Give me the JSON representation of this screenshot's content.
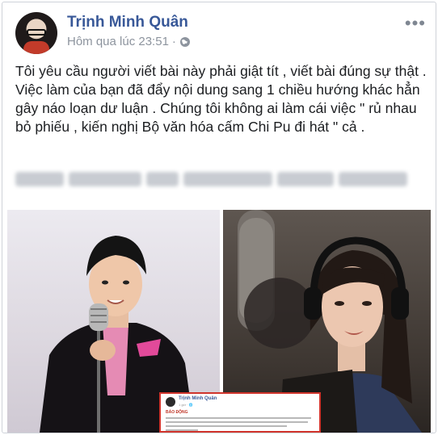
{
  "post": {
    "author": "Trịnh Minh Quân",
    "timestamp": "Hôm qua lúc 23:51",
    "separator": "·",
    "text": "Tôi yêu cầu người viết bài này phải giật tít , viết bài đúng sự thật . Việc làm của bạn đã đẩy nội dung sang 1 chiều hướng khác hẳn gây náo loạn dư luận . Chúng tôi không ai làm cái việc \" rủ nhau bỏ phiếu , kiến nghị Bộ văn hóa cấm Chi Pu  đi hát \" cả  .",
    "more_label": "•••"
  },
  "embed": {
    "author": "Trịnh Minh Quân",
    "time": "1 giờ · 🌐",
    "title": "BÁO ĐỘNG"
  },
  "colors": {
    "link": "#385898",
    "meta": "#8d949e",
    "embed_border": "#d0342c"
  },
  "icons": [
    "globe-icon",
    "more-options-icon",
    "avatar"
  ]
}
